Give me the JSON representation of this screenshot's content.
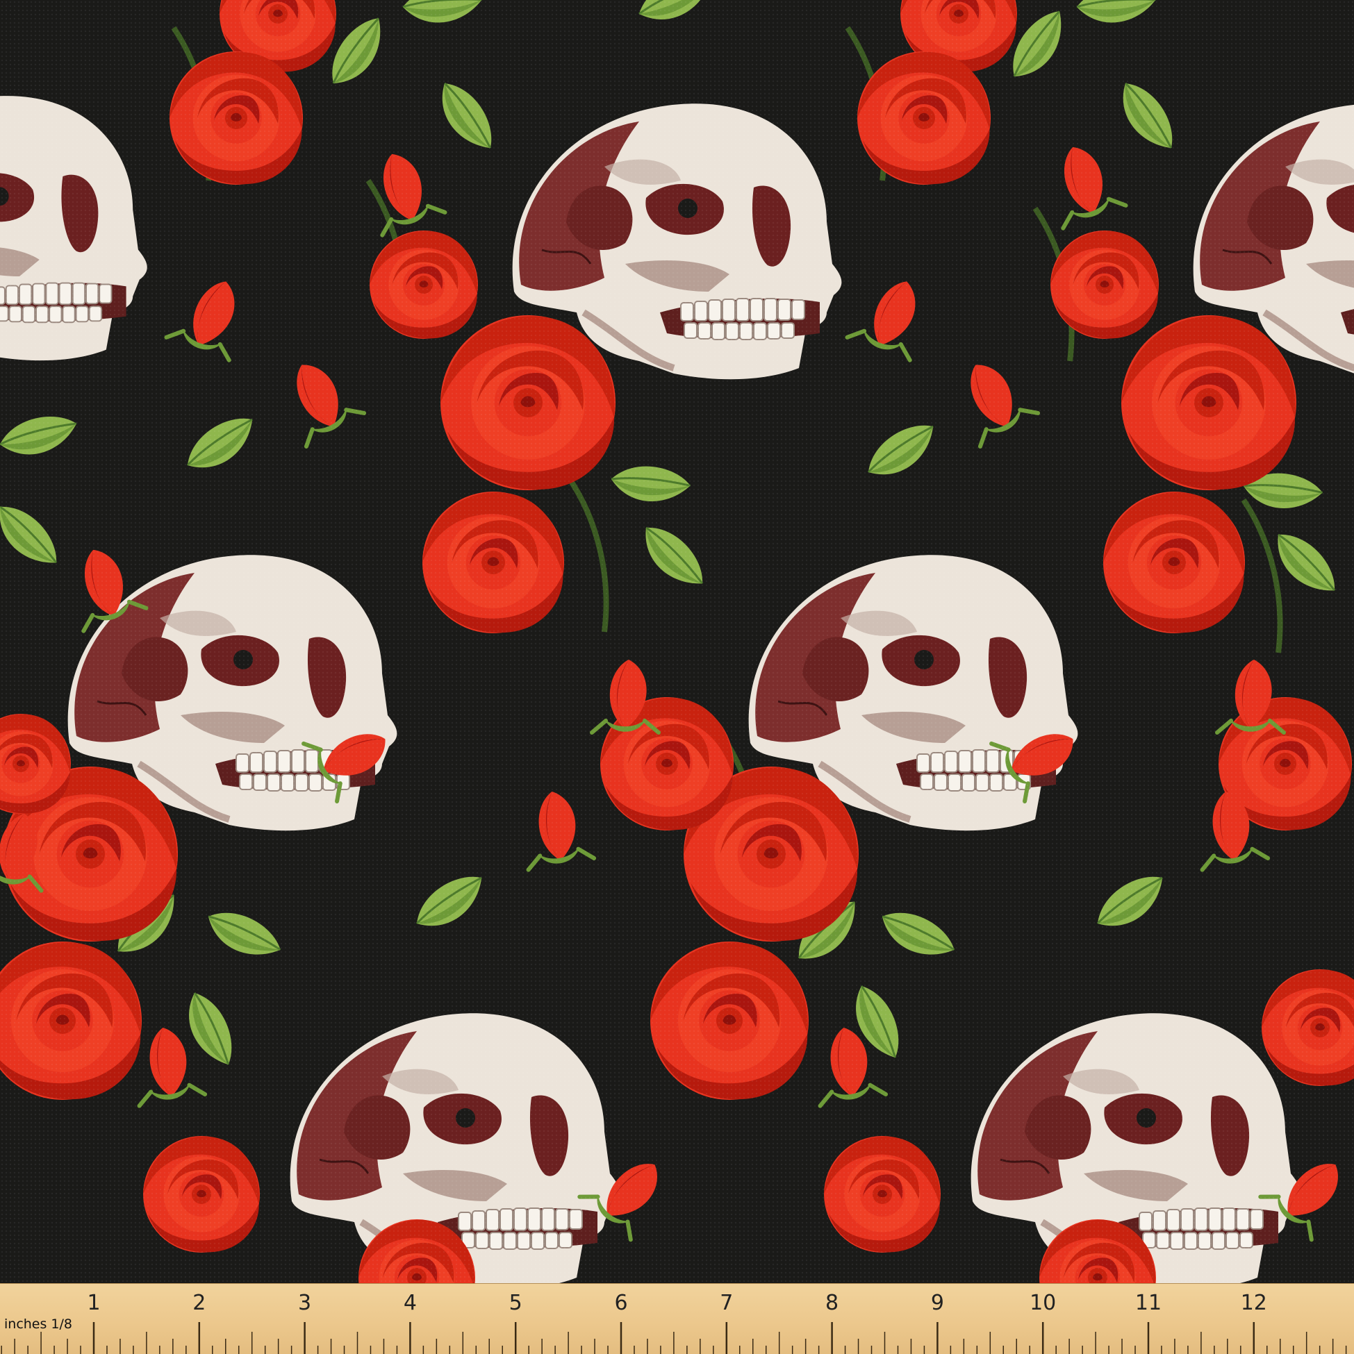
{
  "fabric": {
    "motifs": [
      "skull-motif",
      "red-rose-motif",
      "rose-bud-motif",
      "green-leaf-motif"
    ],
    "colors": {
      "background": "#1a1a18",
      "bone": "#ece4da",
      "bone_shadow": "#b79f95",
      "bone_dark": "#7d2e2d",
      "rose": "#e8331f",
      "rose_dark": "#a9150f",
      "leaf": "#8fb74d",
      "leaf_dark": "#4d7a2b"
    }
  },
  "ruler": {
    "label": "inches 1/8",
    "numbers": [
      "1",
      "2",
      "3",
      "4",
      "5",
      "6",
      "7",
      "8",
      "9",
      "10",
      "11",
      "12",
      "1"
    ]
  }
}
